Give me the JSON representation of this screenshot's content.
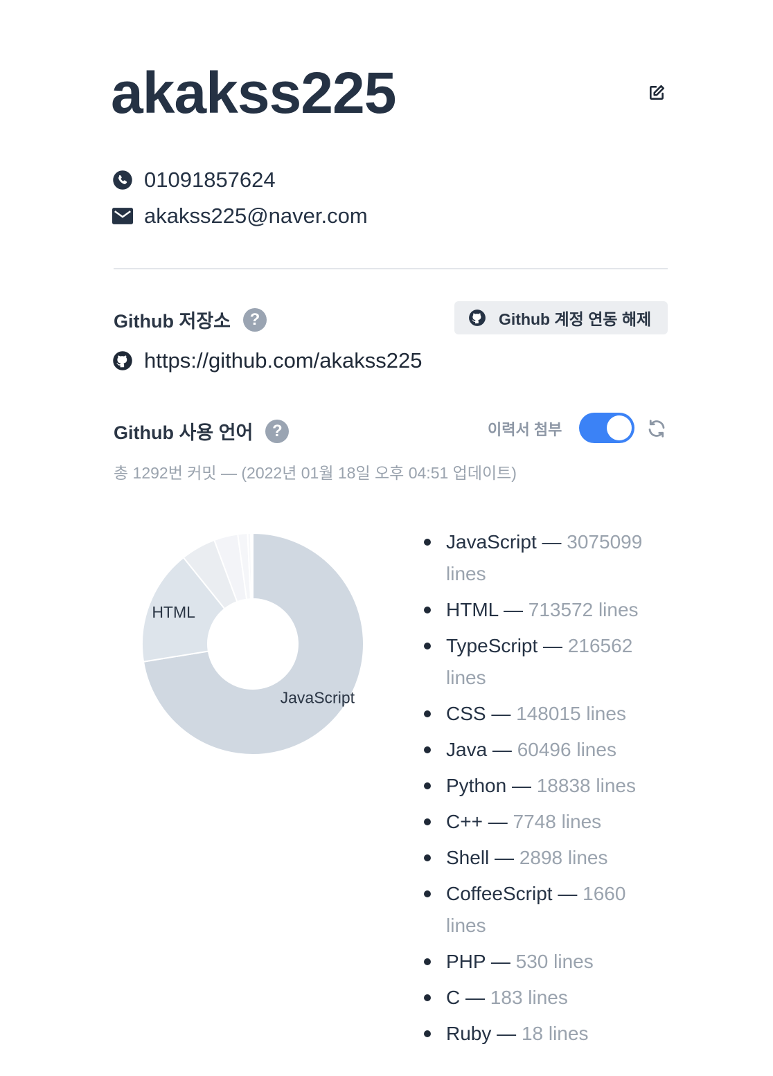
{
  "profile": {
    "name": "akakss225",
    "phone": "01091857624",
    "email": "akakss225@naver.com"
  },
  "github_repo": {
    "title": "Github 저장소",
    "help": "?",
    "disconnect_label": "Github 계정 연동 해제",
    "url": "https://github.com/akakss225"
  },
  "github_lang": {
    "title": "Github 사용 언어",
    "help": "?",
    "attach_label": "이력서 첨부",
    "attach_enabled": true,
    "commit_info": "총 1292번 커밋 — (2022년 01월 18일 오후 04:51 업데이트)"
  },
  "icons": {
    "edit": "edit-icon",
    "phone": "phone-icon",
    "email": "mail-icon",
    "github": "github-icon",
    "refresh": "refresh-icon"
  },
  "colors": {
    "toggle_on": "#3b82f6",
    "slice_colors": [
      "#d0d8e1",
      "#dde4eb",
      "#eaedf1",
      "#f3f4f8",
      "#f5f6f9",
      "#f7f8fa",
      "#f9fafb",
      "#fafbfc",
      "#fbfbfc",
      "#fcfcfd",
      "#fdfdfd",
      "#fefefe"
    ]
  },
  "chart_data": {
    "type": "pie",
    "donut": true,
    "categories": [
      "JavaScript",
      "HTML",
      "TypeScript",
      "CSS",
      "Java",
      "Python",
      "C++",
      "Shell",
      "CoffeeScript",
      "PHP",
      "C",
      "Ruby"
    ],
    "values": [
      3075099,
      713572,
      216562,
      148015,
      60496,
      18838,
      7748,
      2898,
      1660,
      530,
      183,
      18
    ],
    "slice_labels_shown": [
      "JavaScript",
      "HTML"
    ]
  },
  "languages": [
    {
      "name": "JavaScript",
      "sep": " — ",
      "lines": "3075099 lines"
    },
    {
      "name": "HTML",
      "sep": " — ",
      "lines": "713572 lines"
    },
    {
      "name": "TypeScript",
      "sep": " — ",
      "lines": "216562 lines"
    },
    {
      "name": "CSS",
      "sep": " — ",
      "lines": "148015 lines"
    },
    {
      "name": "Java",
      "sep": " — ",
      "lines": "60496 lines"
    },
    {
      "name": "Python",
      "sep": " — ",
      "lines": "18838 lines"
    },
    {
      "name": "C++",
      "sep": " — ",
      "lines": "7748 lines"
    },
    {
      "name": "Shell",
      "sep": " — ",
      "lines": "2898 lines"
    },
    {
      "name": "CoffeeScript",
      "sep": " — ",
      "lines": "1660 lines"
    },
    {
      "name": "PHP",
      "sep": " — ",
      "lines": "530 lines"
    },
    {
      "name": "C",
      "sep": " — ",
      "lines": "183 lines"
    },
    {
      "name": "Ruby",
      "sep": " — ",
      "lines": "18 lines"
    }
  ]
}
